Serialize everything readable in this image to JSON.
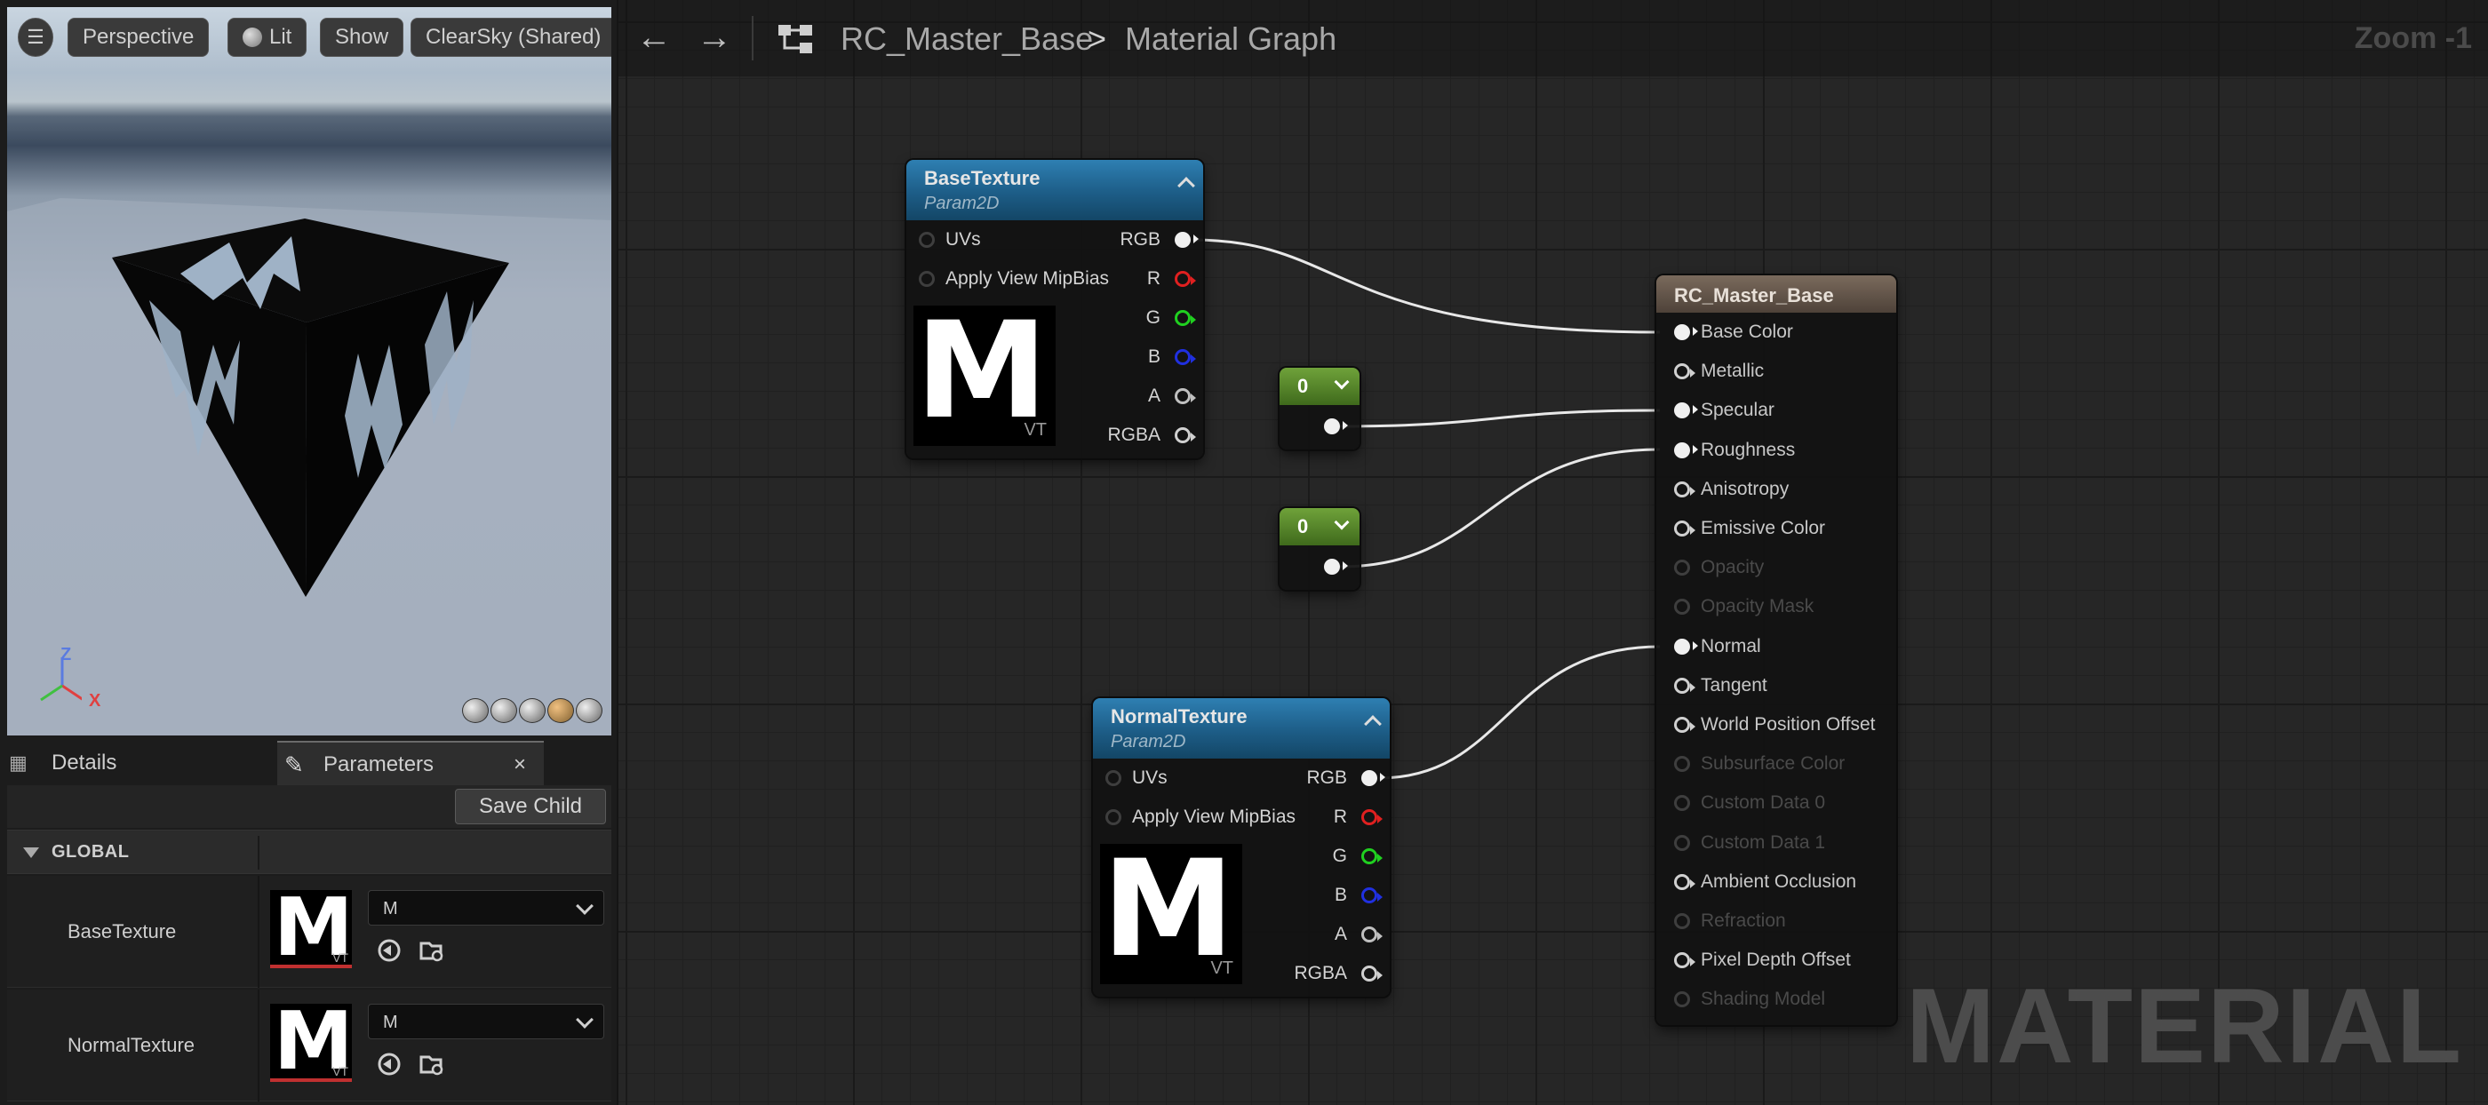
{
  "viewport": {
    "menu_icon": "hamburger-icon",
    "perspective_label": "Perspective",
    "lit_label": "Lit",
    "show_label": "Show",
    "sky_label": "ClearSky (Shared)",
    "axis_z": "Z",
    "axis_x": "X"
  },
  "panel": {
    "tab_details": "Details",
    "tab_parameters": "Parameters",
    "save_child_label": "Save Child",
    "global_label": "GLOBAL",
    "params": [
      {
        "name": "BaseTexture",
        "value": "M",
        "thumb_letter": "M",
        "thumb_badge": "VT"
      },
      {
        "name": "NormalTexture",
        "value": "M",
        "thumb_letter": "M",
        "thumb_badge": "VT"
      }
    ]
  },
  "graph": {
    "breadcrumb_asset": "RC_Master_Base",
    "breadcrumb_sep": ">",
    "breadcrumb_graph": "Material Graph",
    "zoom_label": "Zoom -1",
    "watermark": "MATERIAL",
    "base_texture_node": {
      "title": "BaseTexture",
      "subtitle": "Param2D",
      "inputs": [
        "UVs",
        "Apply View MipBias"
      ],
      "outputs": [
        "RGB",
        "R",
        "G",
        "B",
        "A",
        "RGBA"
      ],
      "preview_letter": "M",
      "preview_badge": "VT"
    },
    "normal_texture_node": {
      "title": "NormalTexture",
      "subtitle": "Param2D",
      "inputs": [
        "UVs",
        "Apply View MipBias"
      ],
      "outputs": [
        "RGB",
        "R",
        "G",
        "B",
        "A",
        "RGBA"
      ],
      "preview_letter": "M",
      "preview_badge": "VT"
    },
    "constant_nodes": [
      {
        "value": "0"
      },
      {
        "value": "0"
      }
    ],
    "result_node": {
      "title": "RC_Master_Base",
      "pins": [
        {
          "label": "Base Color",
          "connected": true,
          "enabled": true
        },
        {
          "label": "Metallic",
          "connected": false,
          "enabled": true
        },
        {
          "label": "Specular",
          "connected": true,
          "enabled": true
        },
        {
          "label": "Roughness",
          "connected": true,
          "enabled": true
        },
        {
          "label": "Anisotropy",
          "connected": false,
          "enabled": true
        },
        {
          "label": "Emissive Color",
          "connected": false,
          "enabled": true
        },
        {
          "label": "Opacity",
          "connected": false,
          "enabled": false
        },
        {
          "label": "Opacity Mask",
          "connected": false,
          "enabled": false
        },
        {
          "label": "Normal",
          "connected": true,
          "enabled": true
        },
        {
          "label": "Tangent",
          "connected": false,
          "enabled": true
        },
        {
          "label": "World Position Offset",
          "connected": false,
          "enabled": true
        },
        {
          "label": "Subsurface Color",
          "connected": false,
          "enabled": false
        },
        {
          "label": "Custom Data 0",
          "connected": false,
          "enabled": false
        },
        {
          "label": "Custom Data 1",
          "connected": false,
          "enabled": false
        },
        {
          "label": "Ambient Occlusion",
          "connected": false,
          "enabled": true
        },
        {
          "label": "Refraction",
          "connected": false,
          "enabled": false
        },
        {
          "label": "Pixel Depth Offset",
          "connected": false,
          "enabled": true
        },
        {
          "label": "Shading Model",
          "connected": false,
          "enabled": false
        }
      ]
    }
  },
  "colors": {
    "texture_header": "#1d5d87",
    "constant_header": "#5a8a2c",
    "result_header": "#6a5a4c",
    "pin_r": "#e02020",
    "pin_g": "#20d020",
    "pin_b": "#2030e0"
  }
}
